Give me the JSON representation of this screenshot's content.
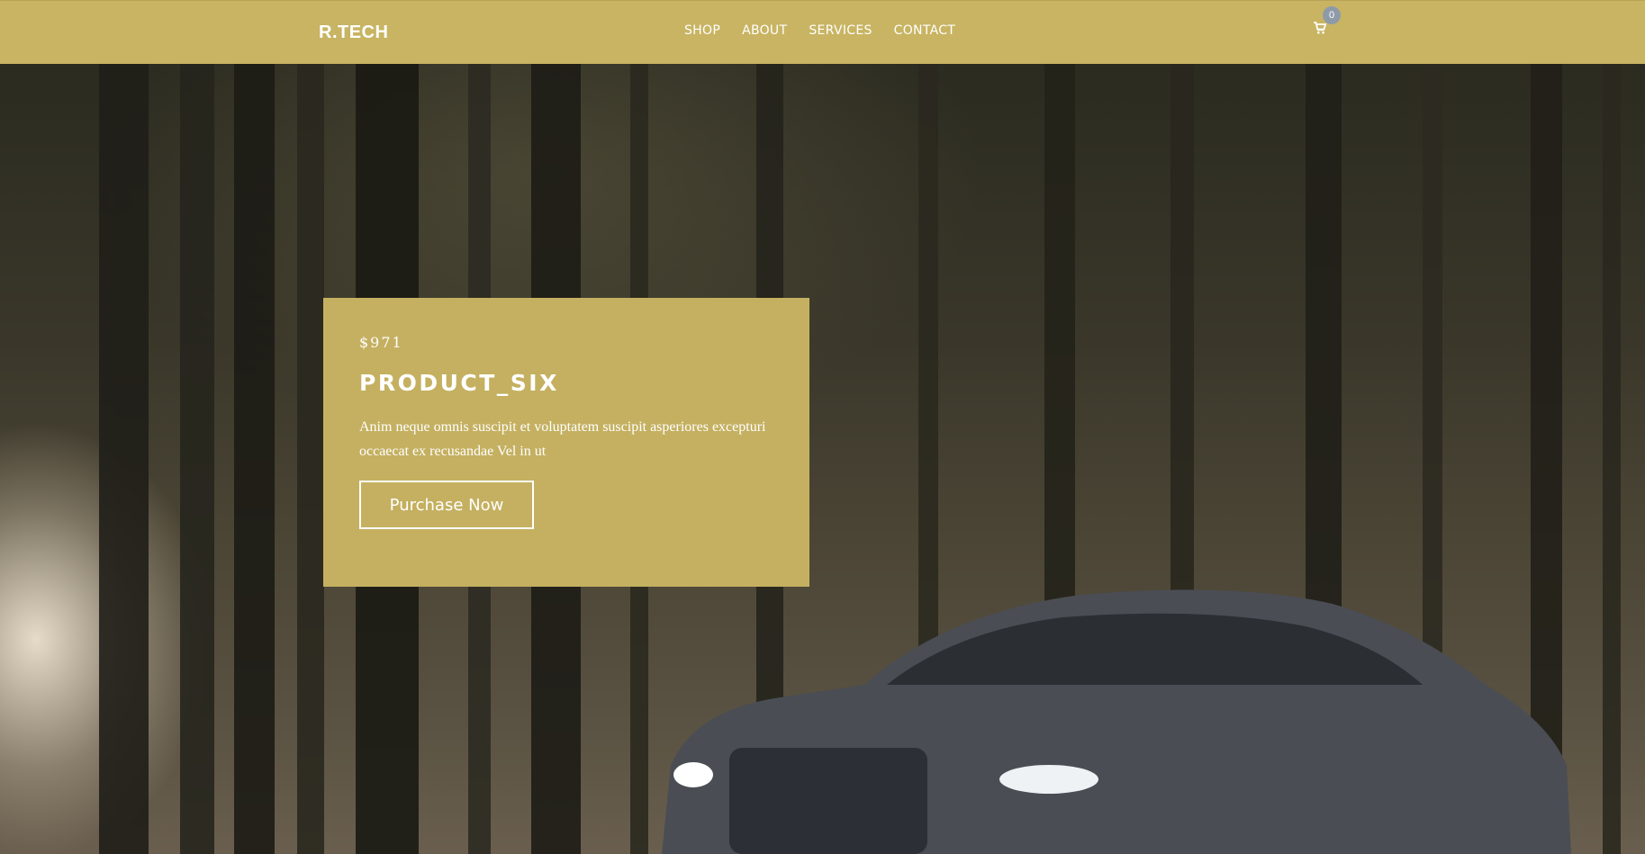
{
  "header": {
    "brand": "R.TECH",
    "nav": [
      {
        "label": "SHOP"
      },
      {
        "label": "ABOUT"
      },
      {
        "label": "SERVICES"
      },
      {
        "label": "CONTACT"
      }
    ],
    "cart": {
      "icon": "shopping-cart-icon",
      "count": "0"
    }
  },
  "hero": {
    "price": "$971",
    "title": "PRODUCT_SIX",
    "description": "Anim neque omnis suscipit et voluptatem suscipit asperiores excepturi occaecat ex recusandae Vel in ut",
    "button_label": "Purchase Now"
  },
  "colors": {
    "accent": "#c8b462",
    "card": "#c4b060",
    "text": "#ffffff"
  }
}
